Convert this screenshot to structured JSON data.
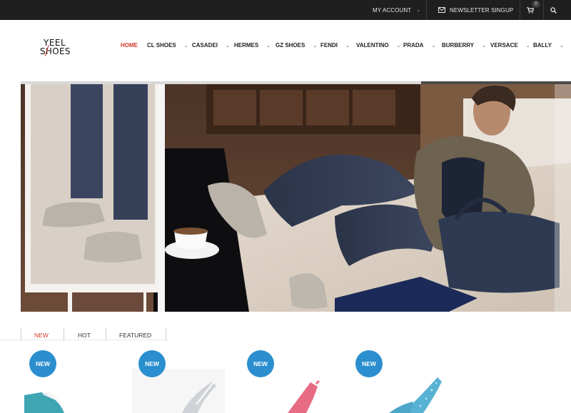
{
  "topbar": {
    "account_label": "MY ACCOUNT",
    "newsletter_label": "NEWSLETTER SINGUP",
    "cart_count": "0"
  },
  "logo": {
    "line1": "YEEL",
    "line2": "SHOES"
  },
  "nav": {
    "items": [
      {
        "label": "HOME",
        "active": true
      },
      {
        "label": "CL SHOES"
      },
      {
        "label": "CASADEI"
      },
      {
        "label": "HERMES"
      },
      {
        "label": "GZ SHOES"
      },
      {
        "label": "FENDI"
      },
      {
        "label": "VALENTINO"
      },
      {
        "label": "PRADA"
      },
      {
        "label": "BURBERRY"
      },
      {
        "label": "VERSACE"
      },
      {
        "label": "BALLY"
      }
    ]
  },
  "tabs": {
    "items": [
      {
        "label": "NEW",
        "active": true
      },
      {
        "label": "HOT"
      },
      {
        "label": "FEATURED"
      }
    ]
  },
  "products": {
    "badges": [
      "NEW",
      "NEW",
      "NEW",
      "NEW"
    ]
  },
  "colors": {
    "accent": "#d0392b",
    "badge": "#2b8fcf",
    "topbar": "#1f1f1f"
  }
}
